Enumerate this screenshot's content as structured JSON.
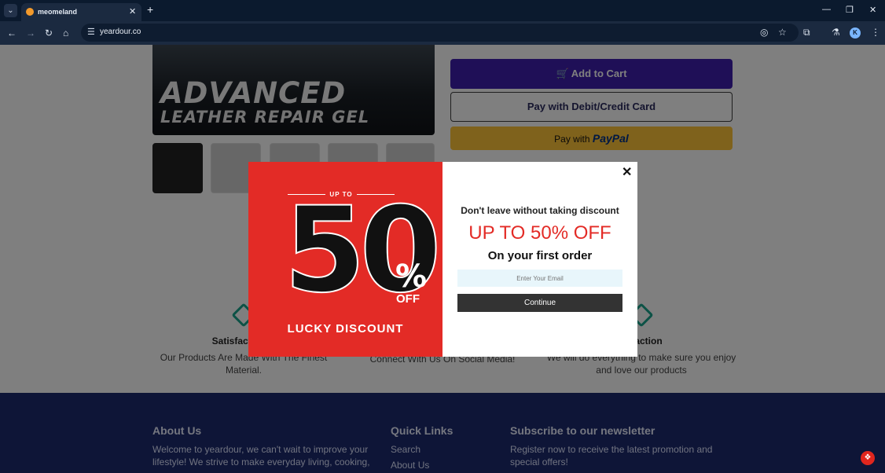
{
  "browser": {
    "tab_title": "meomeland",
    "url": "yeardour.co",
    "icons": [
      "tab-search-icon",
      "tab-favicon-icon",
      "close-tab-icon",
      "new-tab-icon",
      "minimize-icon",
      "restore-icon",
      "close-window-icon",
      "back-icon",
      "forward-icon",
      "reload-icon",
      "home-icon",
      "site-settings-icon",
      "eye-off-icon",
      "star-icon",
      "extensions-icon",
      "labs-icon",
      "profile-icon",
      "more-icon"
    ]
  },
  "hero": {
    "line1": "ADVANCED",
    "line2": "LEATHER REPAIR GEL"
  },
  "buttons": {
    "add_to_cart": "Add to Cart",
    "pay_card": "Pay with Debit/Credit Card",
    "paypal_prefix": "Pay with",
    "paypal_brand": "PayPal"
  },
  "features": [
    {
      "title": "Satisfaction G",
      "desc": "Our Products Are Made With The Finest Material."
    },
    {
      "title": "",
      "desc": "Got Questions? We Got Answers! Just Email Or Connect With Us On Social Media!"
    },
    {
      "title": "tisfaction",
      "desc": "We will do everything to make sure you enjoy and love our products"
    }
  ],
  "footer": {
    "about": {
      "heading": "About Us",
      "text": "Welcome to yeardour, we can't wait to improve your lifestyle! We strive to make everyday living, cooking,"
    },
    "links": {
      "heading": "Quick Links",
      "items": [
        "Search",
        "About Us"
      ]
    },
    "newsletter": {
      "heading": "Subscribe to our newsletter",
      "text": "Register now to receive the latest promotion and special offers!"
    }
  },
  "popup": {
    "upto": "UP TO",
    "fifty": "50",
    "percent": "%",
    "off": "OFF",
    "lucky": "LUCKY DISCOUNT",
    "heading": "Don't leave without taking discount",
    "big": "UP TO 50% OFF",
    "sub": "On your first order",
    "email_placeholder": "Enter Your Email",
    "continue": "Continue",
    "close": "✕"
  },
  "colors": {
    "accent": "#3f1fae",
    "promo_red": "#e32b26",
    "paypal": "#ffc439",
    "teal": "#18a48c"
  }
}
